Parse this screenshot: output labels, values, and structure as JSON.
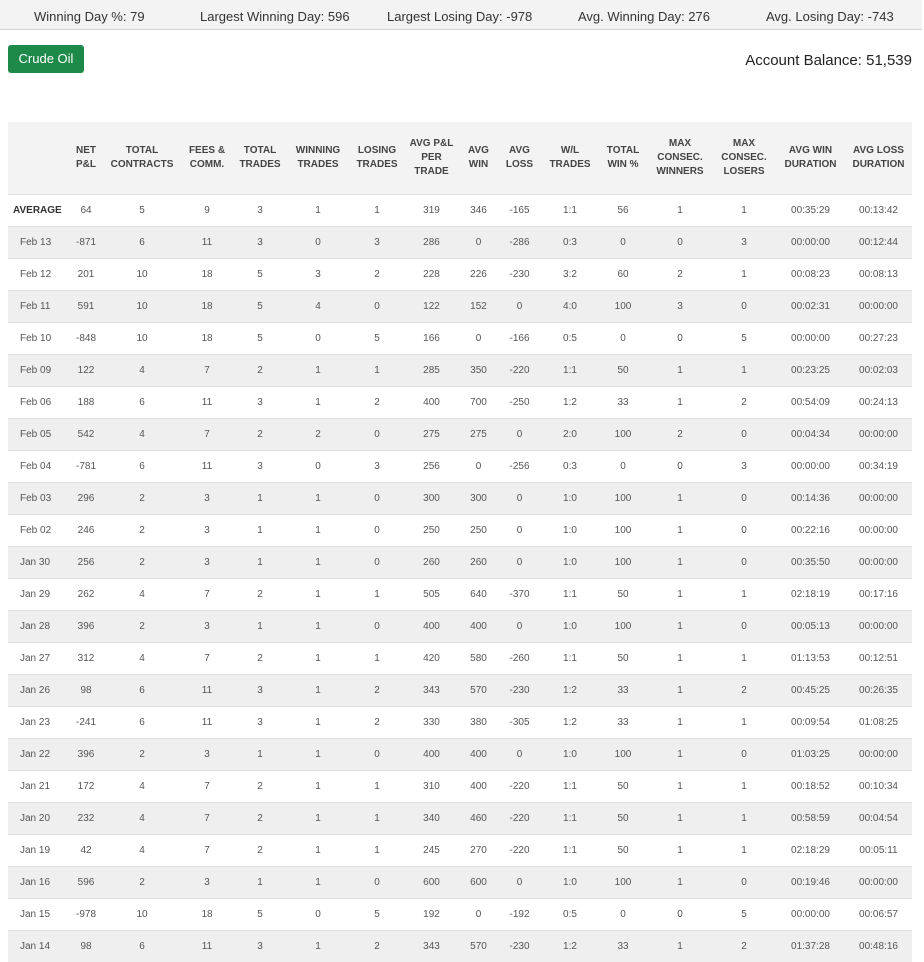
{
  "stats": {
    "winning_day_pct": "Winning Day %: 79",
    "largest_winning_day": "Largest Winning Day: 596",
    "largest_losing_day": "Largest Losing Day: -978",
    "avg_winning_day": "Avg. Winning Day: 276",
    "avg_losing_day": "Avg. Losing Day: -743"
  },
  "instrument_button": "Crude Oil",
  "account_balance": "Account Balance: 51,539",
  "table": {
    "headers": [
      "",
      "NET P&L",
      "TOTAL CONTRACTS",
      "FEES & COMM.",
      "TOTAL TRADES",
      "WINNING TRADES",
      "LOSING TRADES",
      "AVG P&L PER TRADE",
      "AVG WIN",
      "AVG LOSS",
      "W/L TRADES",
      "TOTAL WIN %",
      "MAX CONSEC. WINNERS",
      "MAX CONSEC. LOSERS",
      "AVG WIN DURATION",
      "AVG LOSS DURATION"
    ],
    "rows": [
      [
        "AVERAGE",
        "64",
        "5",
        "9",
        "3",
        "1",
        "1",
        "319",
        "346",
        "-165",
        "1:1",
        "56",
        "1",
        "1",
        "00:35:29",
        "00:13:42"
      ],
      [
        "Feb 13",
        "-871",
        "6",
        "11",
        "3",
        "0",
        "3",
        "286",
        "0",
        "-286",
        "0:3",
        "0",
        "0",
        "3",
        "00:00:00",
        "00:12:44"
      ],
      [
        "Feb 12",
        "201",
        "10",
        "18",
        "5",
        "3",
        "2",
        "228",
        "226",
        "-230",
        "3:2",
        "60",
        "2",
        "1",
        "00:08:23",
        "00:08:13"
      ],
      [
        "Feb 11",
        "591",
        "10",
        "18",
        "5",
        "4",
        "0",
        "122",
        "152",
        "0",
        "4:0",
        "100",
        "3",
        "0",
        "00:02:31",
        "00:00:00"
      ],
      [
        "Feb 10",
        "-848",
        "10",
        "18",
        "5",
        "0",
        "5",
        "166",
        "0",
        "-166",
        "0:5",
        "0",
        "0",
        "5",
        "00:00:00",
        "00:27:23"
      ],
      [
        "Feb 09",
        "122",
        "4",
        "7",
        "2",
        "1",
        "1",
        "285",
        "350",
        "-220",
        "1:1",
        "50",
        "1",
        "1",
        "00:23:25",
        "00:02:03"
      ],
      [
        "Feb 06",
        "188",
        "6",
        "11",
        "3",
        "1",
        "2",
        "400",
        "700",
        "-250",
        "1:2",
        "33",
        "1",
        "2",
        "00:54:09",
        "00:24:13"
      ],
      [
        "Feb 05",
        "542",
        "4",
        "7",
        "2",
        "2",
        "0",
        "275",
        "275",
        "0",
        "2:0",
        "100",
        "2",
        "0",
        "00:04:34",
        "00:00:00"
      ],
      [
        "Feb 04",
        "-781",
        "6",
        "11",
        "3",
        "0",
        "3",
        "256",
        "0",
        "-256",
        "0:3",
        "0",
        "0",
        "3",
        "00:00:00",
        "00:34:19"
      ],
      [
        "Feb 03",
        "296",
        "2",
        "3",
        "1",
        "1",
        "0",
        "300",
        "300",
        "0",
        "1:0",
        "100",
        "1",
        "0",
        "00:14:36",
        "00:00:00"
      ],
      [
        "Feb 02",
        "246",
        "2",
        "3",
        "1",
        "1",
        "0",
        "250",
        "250",
        "0",
        "1:0",
        "100",
        "1",
        "0",
        "00:22:16",
        "00:00:00"
      ],
      [
        "Jan 30",
        "256",
        "2",
        "3",
        "1",
        "1",
        "0",
        "260",
        "260",
        "0",
        "1:0",
        "100",
        "1",
        "0",
        "00:35:50",
        "00:00:00"
      ],
      [
        "Jan 29",
        "262",
        "4",
        "7",
        "2",
        "1",
        "1",
        "505",
        "640",
        "-370",
        "1:1",
        "50",
        "1",
        "1",
        "02:18:19",
        "00:17:16"
      ],
      [
        "Jan 28",
        "396",
        "2",
        "3",
        "1",
        "1",
        "0",
        "400",
        "400",
        "0",
        "1:0",
        "100",
        "1",
        "0",
        "00:05:13",
        "00:00:00"
      ],
      [
        "Jan 27",
        "312",
        "4",
        "7",
        "2",
        "1",
        "1",
        "420",
        "580",
        "-260",
        "1:1",
        "50",
        "1",
        "1",
        "01:13:53",
        "00:12:51"
      ],
      [
        "Jan 26",
        "98",
        "6",
        "11",
        "3",
        "1",
        "2",
        "343",
        "570",
        "-230",
        "1:2",
        "33",
        "1",
        "2",
        "00:45:25",
        "00:26:35"
      ],
      [
        "Jan 23",
        "-241",
        "6",
        "11",
        "3",
        "1",
        "2",
        "330",
        "380",
        "-305",
        "1:2",
        "33",
        "1",
        "1",
        "00:09:54",
        "01:08:25"
      ],
      [
        "Jan 22",
        "396",
        "2",
        "3",
        "1",
        "1",
        "0",
        "400",
        "400",
        "0",
        "1:0",
        "100",
        "1",
        "0",
        "01:03:25",
        "00:00:00"
      ],
      [
        "Jan 21",
        "172",
        "4",
        "7",
        "2",
        "1",
        "1",
        "310",
        "400",
        "-220",
        "1:1",
        "50",
        "1",
        "1",
        "00:18:52",
        "00:10:34"
      ],
      [
        "Jan 20",
        "232",
        "4",
        "7",
        "2",
        "1",
        "1",
        "340",
        "460",
        "-220",
        "1:1",
        "50",
        "1",
        "1",
        "00:58:59",
        "00:04:54"
      ],
      [
        "Jan 19",
        "42",
        "4",
        "7",
        "2",
        "1",
        "1",
        "245",
        "270",
        "-220",
        "1:1",
        "50",
        "1",
        "1",
        "02:18:29",
        "00:05:11"
      ],
      [
        "Jan 16",
        "596",
        "2",
        "3",
        "1",
        "1",
        "0",
        "600",
        "600",
        "0",
        "1:0",
        "100",
        "1",
        "0",
        "00:19:46",
        "00:00:00"
      ],
      [
        "Jan 15",
        "-978",
        "10",
        "18",
        "5",
        "0",
        "5",
        "192",
        "0",
        "-192",
        "0:5",
        "0",
        "0",
        "5",
        "00:00:00",
        "00:06:57"
      ],
      [
        "Jan 14",
        "98",
        "6",
        "11",
        "3",
        "1",
        "2",
        "343",
        "570",
        "-230",
        "1:2",
        "33",
        "1",
        "2",
        "01:37:28",
        "00:48:16"
      ]
    ]
  }
}
